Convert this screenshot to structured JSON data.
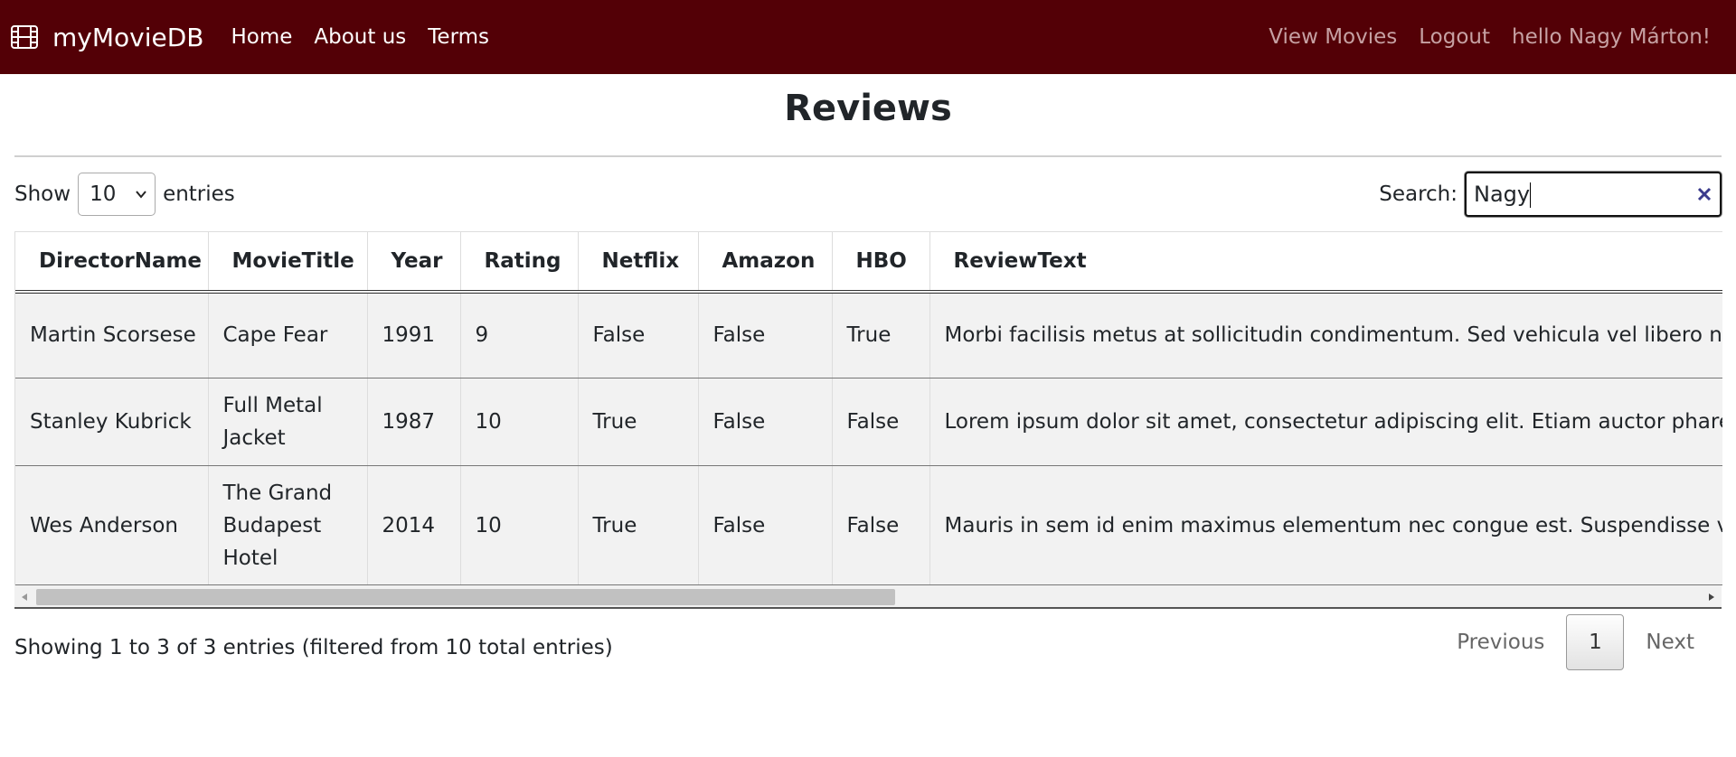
{
  "nav": {
    "brand": "myMovieDB",
    "links": [
      "Home",
      "About us",
      "Terms"
    ],
    "right_links": [
      "View Movies",
      "Logout"
    ],
    "greeting": "hello Nagy Márton!"
  },
  "page": {
    "title": "Reviews"
  },
  "controls": {
    "show_label": "Show",
    "entries_label": "entries",
    "page_length": "10",
    "search_label": "Search:",
    "search_value": "Nagy"
  },
  "table": {
    "columns": [
      "DirectorName",
      "MovieTitle",
      "Year",
      "Rating",
      "Netflix",
      "Amazon",
      "HBO",
      "ReviewText"
    ],
    "rows": [
      [
        "Martin Scorsese",
        "Cape Fear",
        "1991",
        "9",
        "False",
        "False",
        "True",
        "Morbi facilisis metus at sollicitudin condimentum. Sed vehicula vel libero nec plac"
      ],
      [
        "Stanley Kubrick",
        "Full Metal Jacket",
        "1987",
        "10",
        "True",
        "False",
        "False",
        "Lorem ipsum dolor sit amet, consectetur adipiscing elit. Etiam auctor pharetra libe"
      ],
      [
        "Wes Anderson",
        "The Grand Budapest Hotel",
        "2014",
        "10",
        "True",
        "False",
        "False",
        "Mauris in sem id enim maximus elementum nec congue est. Suspendisse vel erat"
      ]
    ]
  },
  "footer": {
    "info": "Showing 1 to 3 of 3 entries (filtered from 10 total entries)",
    "previous": "Previous",
    "current_page": "1",
    "next": "Next"
  },
  "colors": {
    "navbar": "#530006",
    "row_bg": "#f2f2f2"
  },
  "icons": {
    "brand": "film-icon",
    "clear": "clear-x-icon",
    "select": "chevron-down-icon"
  }
}
